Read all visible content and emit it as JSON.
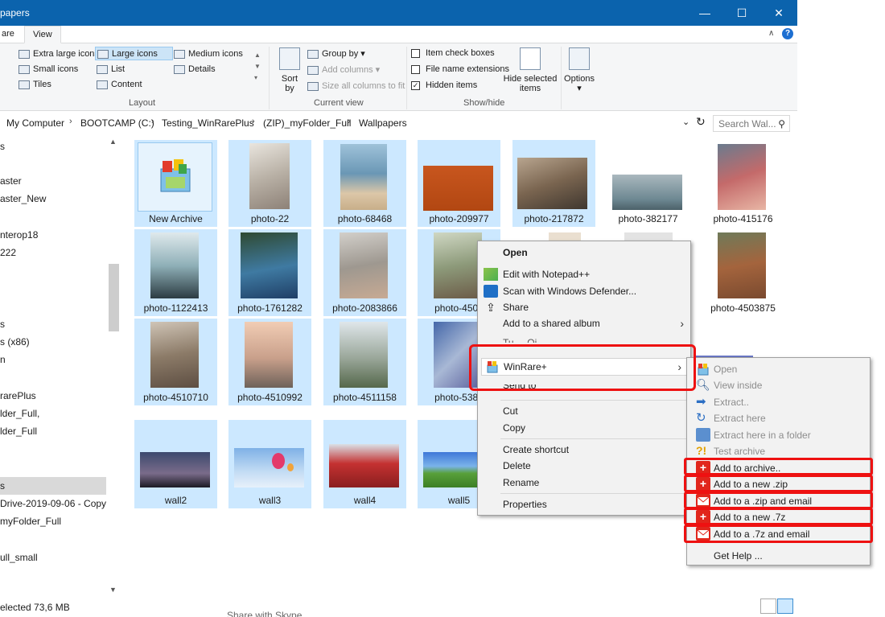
{
  "window": {
    "title": "papers",
    "minimize": "—",
    "maximize": "☐",
    "close": "✕"
  },
  "tabs": [
    "are",
    "View"
  ],
  "ribbon": {
    "help": "?",
    "layout": {
      "label": "Layout",
      "items": [
        "Extra large icons",
        "Large icons",
        "Medium icons",
        "Small icons",
        "List",
        "Details",
        "Tiles",
        "Content"
      ],
      "selected": "Large icons"
    },
    "current_view": {
      "label": "Current view",
      "sort_by": "Sort\nby",
      "group_by": "Group by",
      "add_columns": "Add columns",
      "size_all": "Size all columns to fit"
    },
    "show_hide": {
      "label": "Show/hide",
      "item_check_boxes": "Item check boxes",
      "file_name_extensions": "File name extensions",
      "hidden_items": "Hidden items",
      "hide_selected": "Hide selected\nitems",
      "checked": {
        "item_check_boxes": false,
        "file_name_extensions": false,
        "hidden_items": true
      }
    },
    "options": "Options"
  },
  "address": {
    "crumbs": [
      "My Computer",
      "BOOTCAMP (C:)",
      "Testing_WinRarePlus",
      "(ZIP)_myFolder_Full",
      "Wallpapers"
    ],
    "search_placeholder": "Search Wal..."
  },
  "sidebar": {
    "items": [
      "s",
      "aster",
      "aster_New",
      "nterop18",
      "222",
      "s",
      "s (x86)",
      "n",
      "rarePlus",
      "lder_Full,",
      "lder_Full",
      "s",
      "Drive-2019-09-06 - Copy",
      "myFolder_Full",
      "ull_small"
    ],
    "selected_index": 11
  },
  "files": [
    {
      "name": "New Archive",
      "selected": true
    },
    {
      "name": "photo-22",
      "selected": true
    },
    {
      "name": "photo-68468",
      "selected": true
    },
    {
      "name": "photo-209977",
      "selected": true
    },
    {
      "name": "photo-217872",
      "selected": true
    },
    {
      "name": "photo-382177",
      "selected": false
    },
    {
      "name": "photo-415176",
      "selected": false
    },
    {
      "name": "photo-1122413",
      "selected": true
    },
    {
      "name": "photo-1761282",
      "selected": true
    },
    {
      "name": "photo-2083866",
      "selected": true
    },
    {
      "name": "photo-4503",
      "selected": true
    },
    {
      "name": "photo-4503875",
      "selected": false
    },
    {
      "name": "photo-4510710",
      "selected": true
    },
    {
      "name": "photo-4510992",
      "selected": true
    },
    {
      "name": "photo-4511158",
      "selected": true
    },
    {
      "name": "photo-5384",
      "selected": true
    },
    {
      "name": "wall2",
      "selected": true
    },
    {
      "name": "wall3",
      "selected": true
    },
    {
      "name": "wall4",
      "selected": true
    },
    {
      "name": "wall5",
      "selected": true
    }
  ],
  "status": {
    "text": "elected  73,6 MB",
    "bottom_snippet": "Share with Skype"
  },
  "context_menu": {
    "open": "Open",
    "edit_notepad": "Edit with Notepad++",
    "scan_defender": "Scan with Windows Defender...",
    "share": "Share",
    "add_shared_album": "Add to a shared album",
    "hidden_partial": "Tu ... Oi",
    "winrare": "WinRare+",
    "send_to": "Send to",
    "cut": "Cut",
    "copy": "Copy",
    "create_shortcut": "Create shortcut",
    "delete": "Delete",
    "rename": "Rename",
    "properties": "Properties"
  },
  "submenu": {
    "open": "Open",
    "view_inside": "View inside",
    "extract": "Extract..",
    "extract_here": "Extract here",
    "extract_folder": "Extract here in a folder",
    "test_archive": "Test archive",
    "add_archive": "Add to archive..",
    "add_zip": "Add to a new .zip",
    "add_zip_email": "Add to a .zip and email",
    "add_7z": "Add to a new .7z",
    "add_7z_email": "Add to a .7z and email",
    "get_help": "Get Help ..."
  },
  "colors": {
    "titlebar": "#0b63ad",
    "selection": "#cce8ff",
    "highlight_red": "#ee1111",
    "menu_bg": "#f2f2f2"
  }
}
